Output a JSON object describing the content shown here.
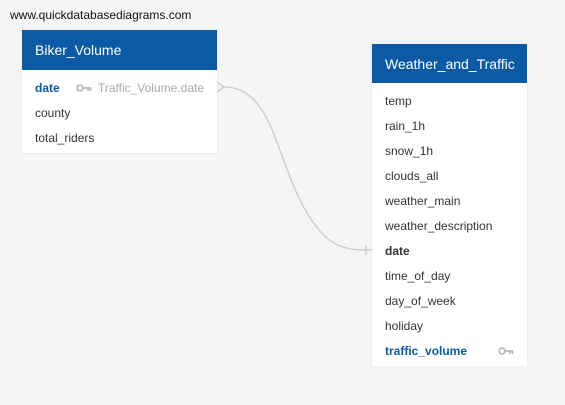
{
  "watermark": "www.quickdatabasediagrams.com",
  "tables": [
    {
      "name": "Biker_Volume",
      "columns": [
        {
          "name": "date",
          "primary_key": true,
          "reference": "Traffic_Volume.date"
        },
        {
          "name": "county"
        },
        {
          "name": "total_riders"
        }
      ]
    },
    {
      "name": "Weather_and_Traffic",
      "columns": [
        {
          "name": "temp"
        },
        {
          "name": "rain_1h"
        },
        {
          "name": "snow_1h"
        },
        {
          "name": "clouds_all"
        },
        {
          "name": "weather_main"
        },
        {
          "name": "weather_description"
        },
        {
          "name": "date",
          "foreign_key_target": true
        },
        {
          "name": "time_of_day"
        },
        {
          "name": "day_of_week"
        },
        {
          "name": "holiday"
        },
        {
          "name": "traffic_volume",
          "primary_key": true
        }
      ]
    }
  ],
  "relationship": {
    "from": "Biker_Volume.date",
    "to": "Weather_and_Traffic.date",
    "from_end": "many",
    "to_end": "one"
  },
  "colors": {
    "header": "#0b5aa3",
    "primary_key_text": "#0b5aa3",
    "connector": "#c8c8c8",
    "background": "#f4f5f6"
  }
}
